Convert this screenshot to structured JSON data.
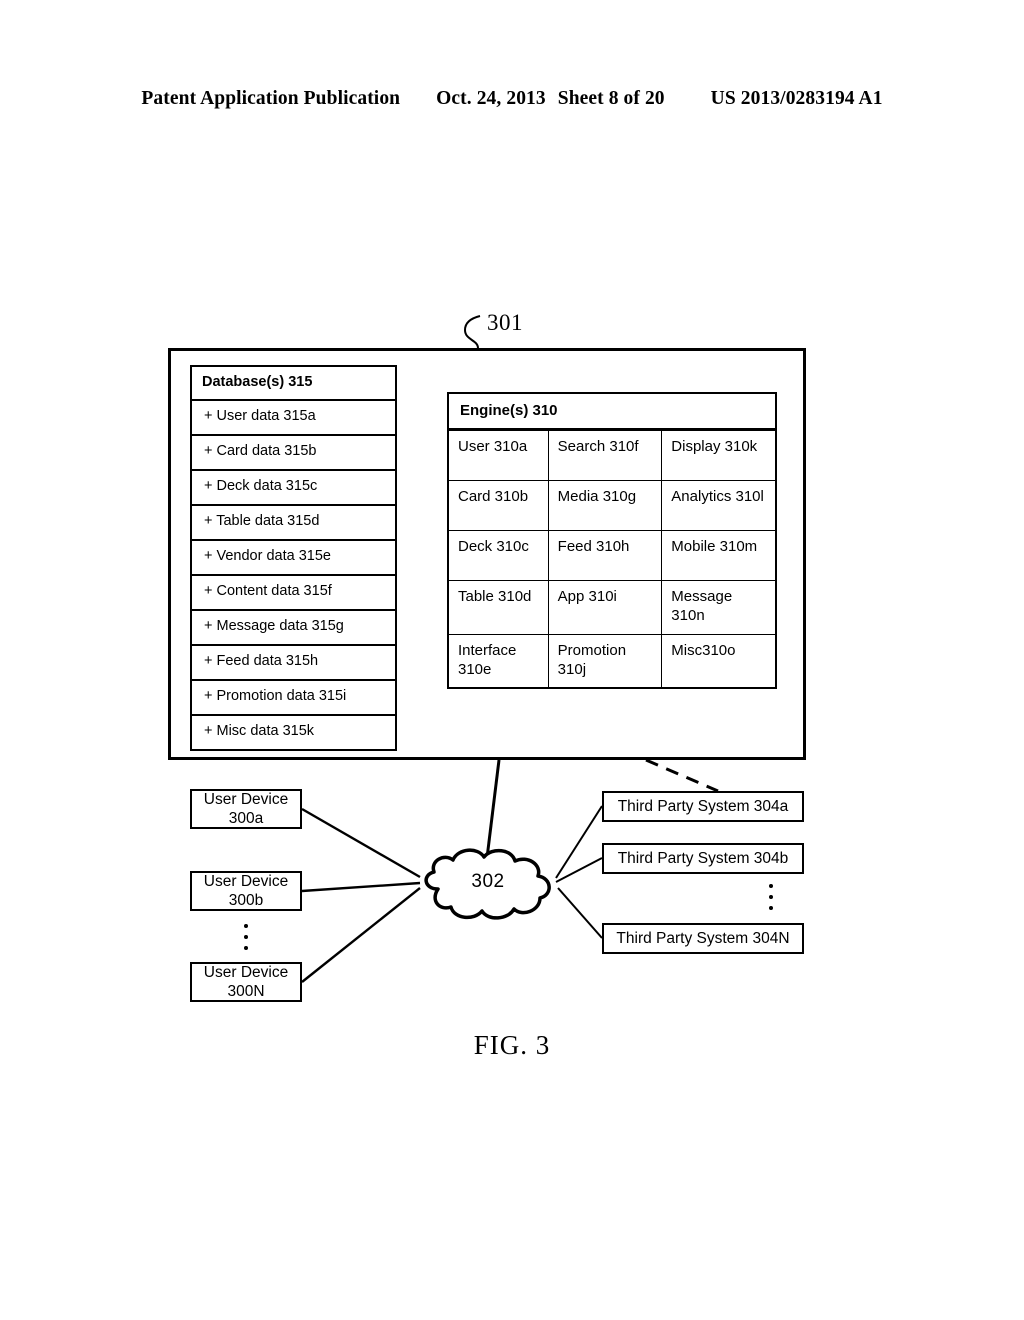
{
  "header": {
    "publication": "Patent Application Publication",
    "date": "Oct. 24, 2013",
    "sheet": "Sheet 8 of 20",
    "patent_number": "US 2013/0283194 A1"
  },
  "figure": {
    "caption": "FIG. 3",
    "system_ref": "301",
    "network_ref": "302"
  },
  "database": {
    "title": "Database(s) 315",
    "rows": [
      "+ User data 315a",
      "+ Card data 315b",
      "+ Deck data 315c",
      "+ Table data 315d",
      "+ Vendor data 315e",
      "+ Content data 315f",
      "+ Message data 315g",
      "+ Feed data 315h",
      "+ Promotion data 315i",
      "+ Misc data 315k"
    ]
  },
  "engines": {
    "title": "Engine(s) 310",
    "grid": [
      [
        "User 310a",
        "Search 310f",
        "Display 310k"
      ],
      [
        "Card 310b",
        "Media 310g",
        "Analytics 310l"
      ],
      [
        "Deck 310c",
        "Feed 310h",
        "Mobile 310m"
      ],
      [
        "Table 310d",
        "App 310i",
        "Message 310n"
      ],
      [
        "Interface 310e",
        "Promotion 310j",
        "Misc310o"
      ]
    ]
  },
  "user_devices": [
    {
      "line1": "User Device",
      "line2": "300a"
    },
    {
      "line1": "User Device",
      "line2": "300b"
    },
    {
      "line1": "User Device",
      "line2": "300N"
    }
  ],
  "third_party_systems": [
    "Third Party System 304a",
    "Third Party System 304b",
    "Third Party System 304N"
  ],
  "colors": {
    "ink": "#000000",
    "paper": "#ffffff"
  }
}
